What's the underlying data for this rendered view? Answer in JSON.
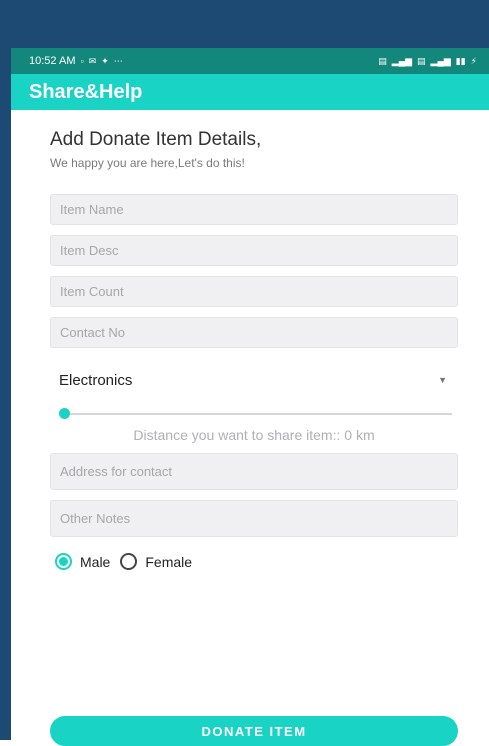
{
  "status_bar": {
    "time": "10:52 AM",
    "left_icons": [
      "sim-icon",
      "message-icon",
      "twitter-icon",
      "more-icon"
    ],
    "right_icons": [
      "volte-icon",
      "signal-icon",
      "volte-icon",
      "signal-icon",
      "battery-icon",
      "charging-icon"
    ]
  },
  "app_bar": {
    "title": "Share&Help",
    "color": "#19d3c5"
  },
  "header": {
    "title": "Add Donate Item Details,",
    "subtitle": "We happy you are here,Let's do this!"
  },
  "form": {
    "item_name_placeholder": "Item Name",
    "item_desc_placeholder": "Item Desc",
    "item_count_placeholder": "Item Count",
    "contact_no_placeholder": "Contact  No",
    "category_selected": "Electronics",
    "distance_value_km": 0,
    "distance_label": "Distance you want to share item:: 0 km",
    "address_placeholder": "Address for contact",
    "notes_placeholder": "Other Notes",
    "gender_options": [
      {
        "label": "Male",
        "selected": true
      },
      {
        "label": "Female",
        "selected": false
      }
    ]
  },
  "actions": {
    "donate_label": "DONATE ITEM"
  }
}
